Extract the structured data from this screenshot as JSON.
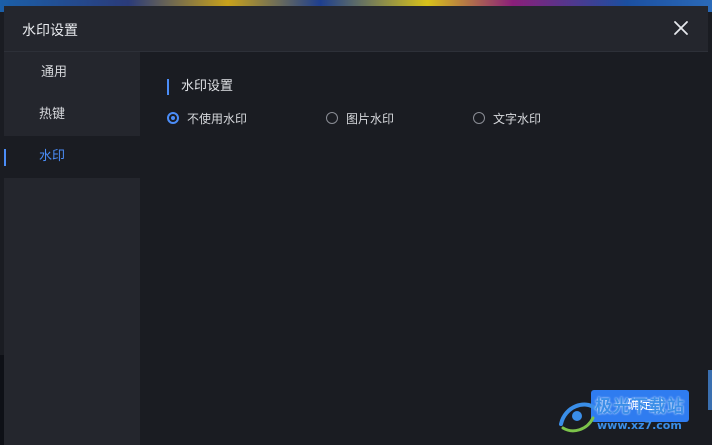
{
  "dialog": {
    "title": "水印设置",
    "close_icon": "close-icon"
  },
  "sidebar": {
    "items": [
      {
        "label": "通用",
        "active": false
      },
      {
        "label": "热键",
        "active": false
      },
      {
        "label": "水印",
        "active": true
      }
    ]
  },
  "content": {
    "section_title": "水印设置",
    "options": [
      {
        "label": "不使用水印",
        "checked": true
      },
      {
        "label": "图片水印",
        "checked": false
      },
      {
        "label": "文字水印",
        "checked": false
      }
    ]
  },
  "footer": {
    "ok_label": "确定"
  },
  "watermark": {
    "name": "极光下载站",
    "url": "www.xz7.com"
  },
  "colors": {
    "accent": "#4b8df8",
    "button": "#2f7cf0",
    "background": "#1a1c22",
    "sidebar": "#24262d"
  }
}
